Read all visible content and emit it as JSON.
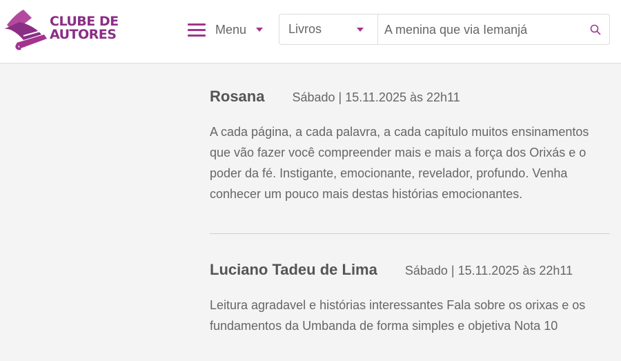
{
  "header": {
    "logo": {
      "line1": "CLUBE DE",
      "line2": "AUTORES"
    },
    "menu_label": "Menu",
    "search": {
      "category": "Livros",
      "placeholder": "A menina que via Iemanjá"
    }
  },
  "reviews": [
    {
      "author": "Rosana",
      "date": "Sábado | 15.11.2025 às 22h11",
      "text": "A cada página, a cada palavra, a cada capítulo muitos ensinamentos que vão fazer você compreender mais e mais a força dos Orixás e o poder da fé. Instigante, emocionante, revelador, profundo. Venha conhecer um pouco mais destas histórias emocionantes."
    },
    {
      "author": "Luciano Tadeu de Lima",
      "date": "Sábado | 15.11.2025 às 22h11",
      "text": "Leitura agradavel e histórias interessantes Fala sobre os orixas e os fundamentos da Umbanda de forma simples e objetiva Nota 10"
    }
  ],
  "colors": {
    "brand": "#8a2e86",
    "accent": "#a3338f"
  }
}
